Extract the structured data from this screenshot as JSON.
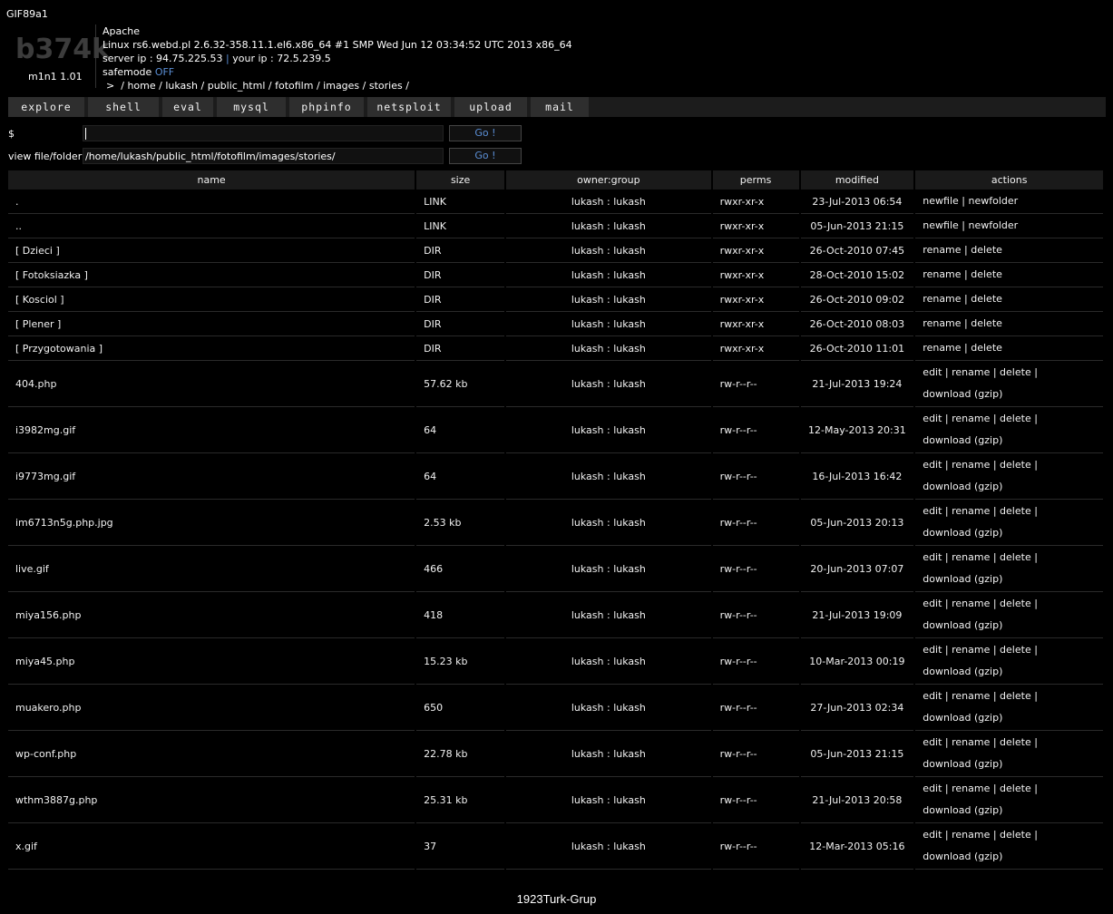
{
  "top_label": "GIF89a1",
  "logo": {
    "text": "b374k",
    "version": "m1n1 1.01"
  },
  "server": {
    "software": "Apache",
    "uname": "Linux rs6.webd.pl 2.6.32-358.11.1.el6.x86_64 #1 SMP Wed Jun 12 03:34:52 UTC 2013 x86_64",
    "server_ip_label": "server ip : 94.75.225.53",
    "sep": "|",
    "your_ip_label": "your ip : 72.5.239.5",
    "safemode_label": "safemode",
    "safemode_value": "OFF",
    "path_prefix": ">",
    "path_parts": [
      "/",
      "home",
      "/",
      "lukash",
      "/",
      "public_html",
      "/",
      "fotofilm",
      "/",
      "images",
      "/",
      "stories",
      "/"
    ]
  },
  "menu": [
    "explore",
    "shell",
    "eval",
    "mysql",
    "phpinfo",
    "netsploit",
    "upload",
    "mail"
  ],
  "command_form": {
    "label": "$",
    "value": "",
    "button": "Go !"
  },
  "view_form": {
    "label": "view file/folder",
    "value": "/home/lukash/public_html/fotofilm/images/stories/",
    "button": "Go !"
  },
  "table": {
    "headers": [
      "name",
      "size",
      "owner:group",
      "perms",
      "modified",
      "actions"
    ],
    "rows": [
      {
        "name": ".",
        "size": "LINK",
        "owner": "lukash : lukash",
        "perms": "rwxr-xr-x",
        "modified": "23-Jul-2013 06:54",
        "actions": "newfile | newfolder",
        "actions2": ""
      },
      {
        "name": "..",
        "size": "LINK",
        "owner": "lukash : lukash",
        "perms": "rwxr-xr-x",
        "modified": "05-Jun-2013 21:15",
        "actions": "newfile | newfolder",
        "actions2": ""
      },
      {
        "name": "[ Dzieci ]",
        "size": "DIR",
        "owner": "lukash : lukash",
        "perms": "rwxr-xr-x",
        "modified": "26-Oct-2010 07:45",
        "actions": "rename | delete",
        "actions2": ""
      },
      {
        "name": "[ Fotoksiazka ]",
        "size": "DIR",
        "owner": "lukash : lukash",
        "perms": "rwxr-xr-x",
        "modified": "28-Oct-2010 15:02",
        "actions": "rename | delete",
        "actions2": ""
      },
      {
        "name": "[ Kosciol ]",
        "size": "DIR",
        "owner": "lukash : lukash",
        "perms": "rwxr-xr-x",
        "modified": "26-Oct-2010 09:02",
        "actions": "rename | delete",
        "actions2": ""
      },
      {
        "name": "[ Plener ]",
        "size": "DIR",
        "owner": "lukash : lukash",
        "perms": "rwxr-xr-x",
        "modified": "26-Oct-2010 08:03",
        "actions": "rename | delete",
        "actions2": ""
      },
      {
        "name": "[ Przygotowania ]",
        "size": "DIR",
        "owner": "lukash : lukash",
        "perms": "rwxr-xr-x",
        "modified": "26-Oct-2010 11:01",
        "actions": "rename | delete",
        "actions2": ""
      },
      {
        "name": "404.php",
        "size": "57.62 kb",
        "owner": "lukash : lukash",
        "perms": "rw-r--r--",
        "modified": "21-Jul-2013 19:24",
        "actions": "edit | rename | delete |",
        "actions2": "download (gzip)"
      },
      {
        "name": "i3982mg.gif",
        "size": "64",
        "owner": "lukash : lukash",
        "perms": "rw-r--r--",
        "modified": "12-May-2013 20:31",
        "actions": "edit | rename | delete |",
        "actions2": "download (gzip)"
      },
      {
        "name": "i9773mg.gif",
        "size": "64",
        "owner": "lukash : lukash",
        "perms": "rw-r--r--",
        "modified": "16-Jul-2013 16:42",
        "actions": "edit | rename | delete |",
        "actions2": "download (gzip)"
      },
      {
        "name": "im6713n5g.php.jpg",
        "size": "2.53 kb",
        "owner": "lukash : lukash",
        "perms": "rw-r--r--",
        "modified": "05-Jun-2013 20:13",
        "actions": "edit | rename | delete |",
        "actions2": "download (gzip)"
      },
      {
        "name": "live.gif",
        "size": "466",
        "owner": "lukash : lukash",
        "perms": "rw-r--r--",
        "modified": "20-Jun-2013 07:07",
        "actions": "edit | rename | delete |",
        "actions2": "download (gzip)"
      },
      {
        "name": "miya156.php",
        "size": "418",
        "owner": "lukash : lukash",
        "perms": "rw-r--r--",
        "modified": "21-Jul-2013 19:09",
        "actions": "edit | rename | delete |",
        "actions2": "download (gzip)"
      },
      {
        "name": "miya45.php",
        "size": "15.23 kb",
        "owner": "lukash : lukash",
        "perms": "rw-r--r--",
        "modified": "10-Mar-2013 00:19",
        "actions": "edit | rename | delete |",
        "actions2": "download (gzip)"
      },
      {
        "name": "muakero.php",
        "size": "650",
        "owner": "lukash : lukash",
        "perms": "rw-r--r--",
        "modified": "27-Jun-2013 02:34",
        "actions": "edit | rename | delete |",
        "actions2": "download (gzip)"
      },
      {
        "name": "wp-conf.php",
        "size": "22.78 kb",
        "owner": "lukash : lukash",
        "perms": "rw-r--r--",
        "modified": "05-Jun-2013 21:15",
        "actions": "edit | rename | delete |",
        "actions2": "download (gzip)"
      },
      {
        "name": "wthm3887g.php",
        "size": "25.31 kb",
        "owner": "lukash : lukash",
        "perms": "rw-r--r--",
        "modified": "21-Jul-2013 20:58",
        "actions": "edit | rename | delete |",
        "actions2": "download (gzip)"
      },
      {
        "name": "x.gif",
        "size": "37",
        "owner": "lukash : lukash",
        "perms": "rw-r--r--",
        "modified": "12-Mar-2013 05:16",
        "actions": "edit | rename | delete |",
        "actions2": "download (gzip)"
      }
    ]
  },
  "footer": "1923Turk-Grup",
  "colors": {
    "background": "#000000",
    "accent": "#5b8fd6",
    "logo": "#3c3c3c"
  }
}
